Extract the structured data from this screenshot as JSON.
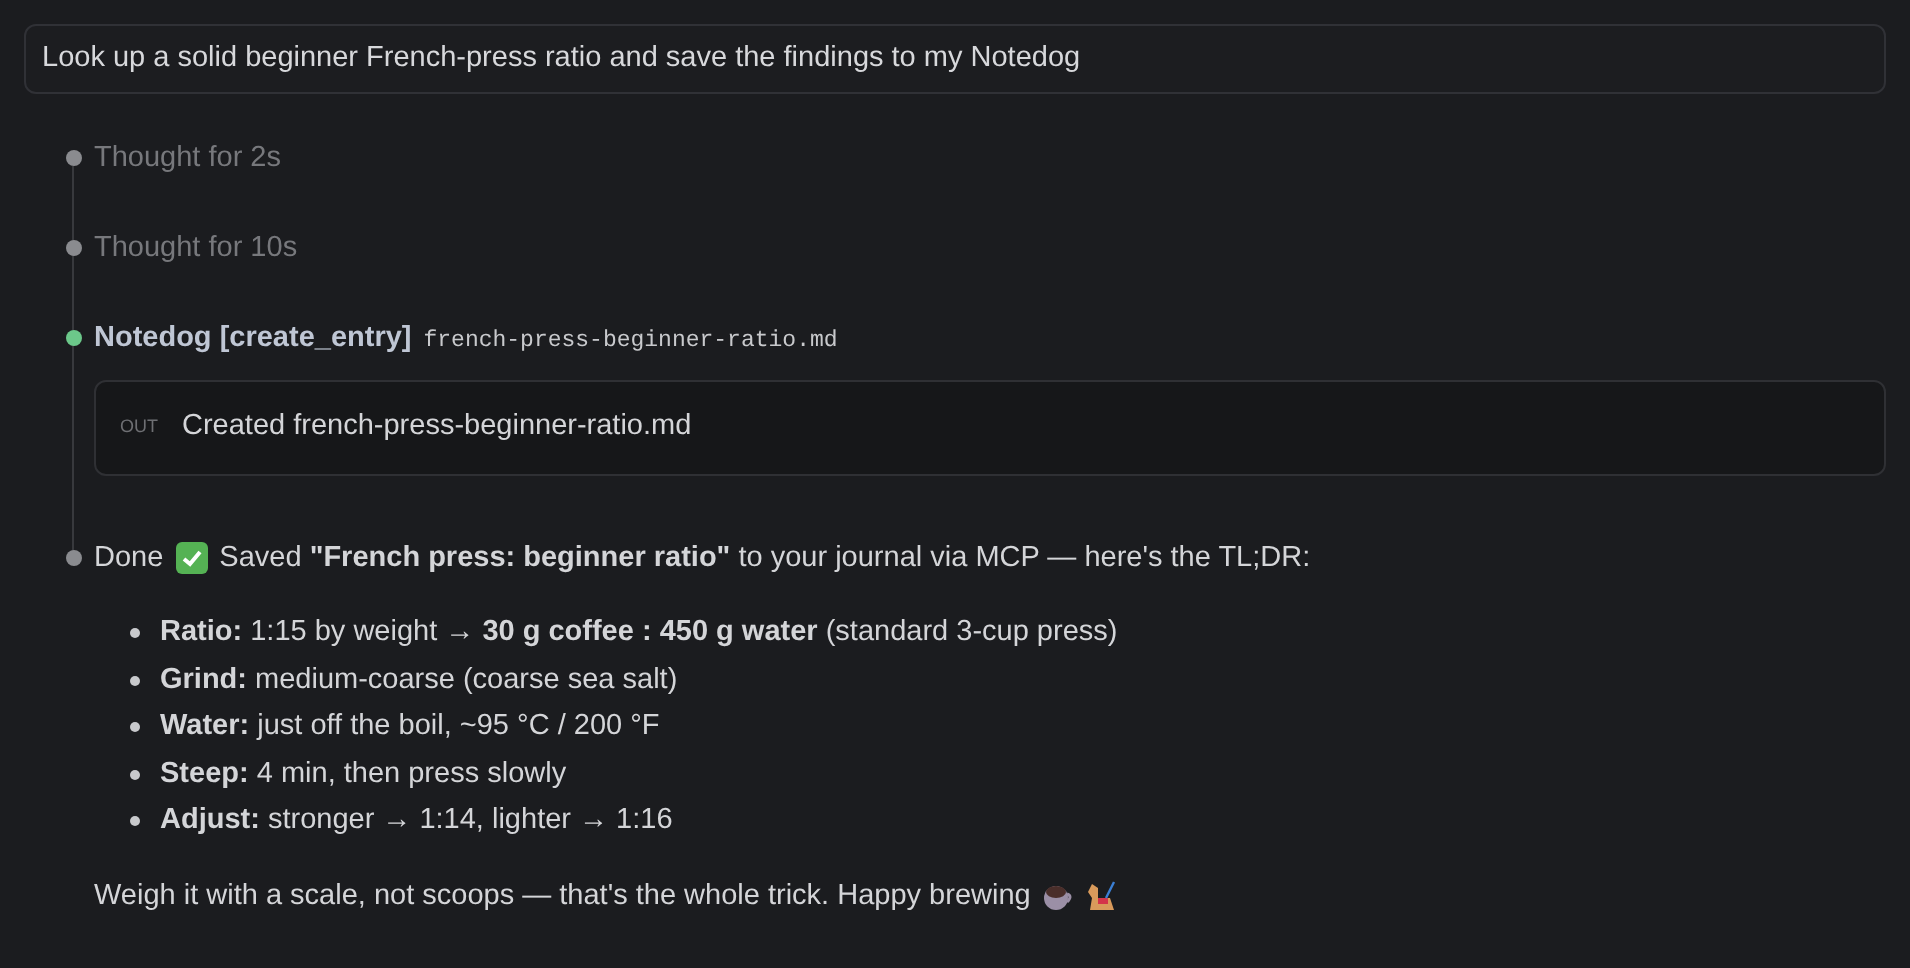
{
  "prompt": {
    "value": "Look up a solid beginner French-press ratio and save the findings to my Notedog"
  },
  "steps": [
    {
      "kind": "thought",
      "color": "#8a8b8f",
      "label": "Thought for 2s"
    },
    {
      "kind": "thought",
      "color": "#8a8b8f",
      "label": "Thought for 10s"
    },
    {
      "kind": "tool",
      "color": "#6cc88a",
      "tool": "Notedog [create_entry]",
      "argument": "french-press-beginner-ratio.md",
      "output_label": "OUT",
      "output": "Created french-press-beginner-ratio.md"
    },
    {
      "kind": "message",
      "color": "#8a8b8f",
      "lead": "Done",
      "intro": "Saved **\"French press: beginner ratio\"** to your journal via MCP — here's the TL;DR:",
      "bullets": [
        "**Ratio:** 1:15 by weight → **30 g coffee : 450 g water** (standard 3-cup press)",
        "**Grind:** medium-coarse (coarse sea salt)",
        "**Water:** just off the boil, ~95 °C / 200 °F",
        "**Steep:** 4 min, then press slowly",
        "**Adjust:** stronger → 1:14, lighter → 1:16"
      ],
      "closing": "Weigh it with a scale, not scoops — that's the whole trick. Happy brewing"
    }
  ]
}
